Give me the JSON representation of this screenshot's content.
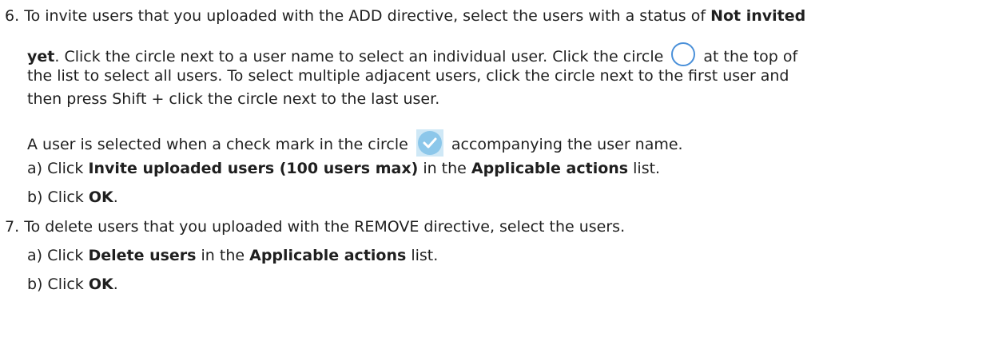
{
  "step6": {
    "num": "6.",
    "line1_a": "To invite users that you uploaded with the ADD directive, select the users with a status of ",
    "line1_b": "Not invited",
    "line2_a": "yet",
    "line2_b": ". Click the circle next to a user name to select an individual user. Click the circle ",
    "line2_c": " at the top of",
    "line3": "the list to select all users. To select multiple adjacent users, click the circle next to the first user and",
    "line4": "then press Shift + click the circle next to the last user.",
    "line5_a": "A user is selected when a check mark in the circle ",
    "line5_b": " accompanying the user name.",
    "sub_a": {
      "label": "a)",
      "t1": "Click ",
      "b1": "Invite uploaded users (100 users max)",
      "t2": " in the ",
      "b2": "Applicable actions",
      "t3": " list."
    },
    "sub_b": {
      "label": "b)",
      "t1": "Click ",
      "b1": "OK",
      "t2": "."
    }
  },
  "step7": {
    "num": "7.",
    "line1": "To delete users that you uploaded with the REMOVE directive, select the users.",
    "sub_a": {
      "label": "a)",
      "t1": "Click ",
      "b1": "Delete users",
      "t2": " in the ",
      "b2": "Applicable actions",
      "t3": " list."
    },
    "sub_b": {
      "label": "b)",
      "t1": "Click ",
      "b1": "OK",
      "t2": "."
    }
  },
  "icons": {
    "select_all": "empty-circle-icon",
    "selected": "checked-circle-icon",
    "accent_color": "#4a90d9"
  }
}
